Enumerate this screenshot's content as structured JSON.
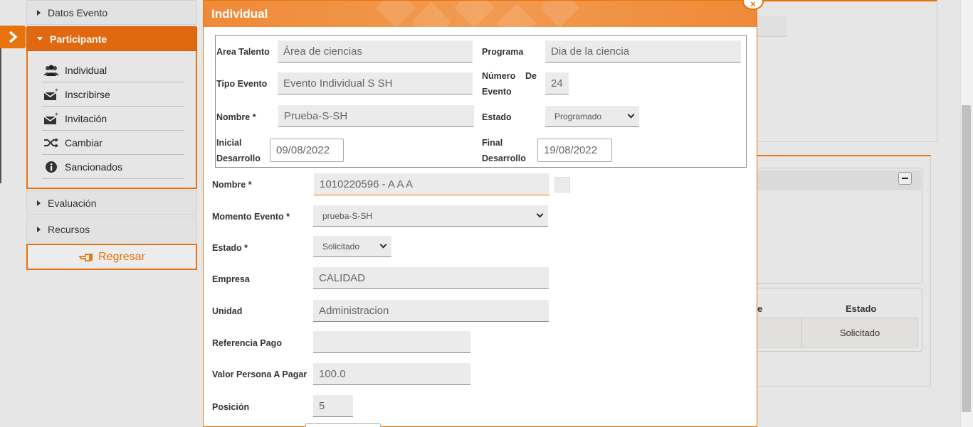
{
  "sidebar": {
    "datos_evento": "Datos Evento",
    "participante": "Participante",
    "items": [
      {
        "label": "Individual",
        "icon": "users-icon"
      },
      {
        "label": "Inscribirse",
        "icon": "envelope-star-icon"
      },
      {
        "label": "Invitación",
        "icon": "envelope-star-icon"
      },
      {
        "label": "Cambiar",
        "icon": "shuffle-icon"
      },
      {
        "label": "Sancionados",
        "icon": "info-icon"
      }
    ],
    "evaluacion": "Evaluación",
    "recursos": "Recursos",
    "regresar": "Regresar"
  },
  "background_table": {
    "col_partial": "e",
    "col_estado": "Estado",
    "cell_estado": "Solicitado"
  },
  "modal": {
    "title": "Individual",
    "close": "×",
    "info": {
      "area_talento_label": "Area Talento",
      "area_talento_value": "Área de ciencias",
      "programa_label": "Programa",
      "programa_value": "Dia de la ciencia",
      "tipo_evento_label": "Tipo Evento",
      "tipo_evento_value": "Evento Individual S SH",
      "numero_evento_label_1": "Número",
      "numero_evento_label_de": "De",
      "numero_evento_label_2": "Evento",
      "numero_evento_value": "24",
      "nombre_label": "Nombre *",
      "nombre_value": "Prueba-S-SH",
      "estado_label": "Estado",
      "estado_value": "Programado",
      "inicial_label_1": "Inicial",
      "inicial_label_2": "Desarrollo",
      "inicial_value": "09/08/2022",
      "final_label_1": "Final",
      "final_label_2": "Desarrollo",
      "final_value": "19/08/2022"
    },
    "form": {
      "nombre_label": "Nombre *",
      "nombre_value": "1010220596 - A A A",
      "momento_label": "Momento Evento *",
      "momento_value": "prueba-S-SH",
      "estado_label": "Estado *",
      "estado_value": "Solicitado",
      "empresa_label": "Empresa",
      "empresa_value": "CALIDAD",
      "unidad_label": "Unidad",
      "unidad_value": "Administracion",
      "referencia_label": "Referencia Pago",
      "referencia_value": "",
      "valor_label": "Valor Persona A Pagar",
      "valor_value": "100.0",
      "posicion_label": "Posición",
      "posicion_value": "5"
    }
  },
  "colors": {
    "accent": "#e8730c",
    "header": "#ef8a38"
  }
}
